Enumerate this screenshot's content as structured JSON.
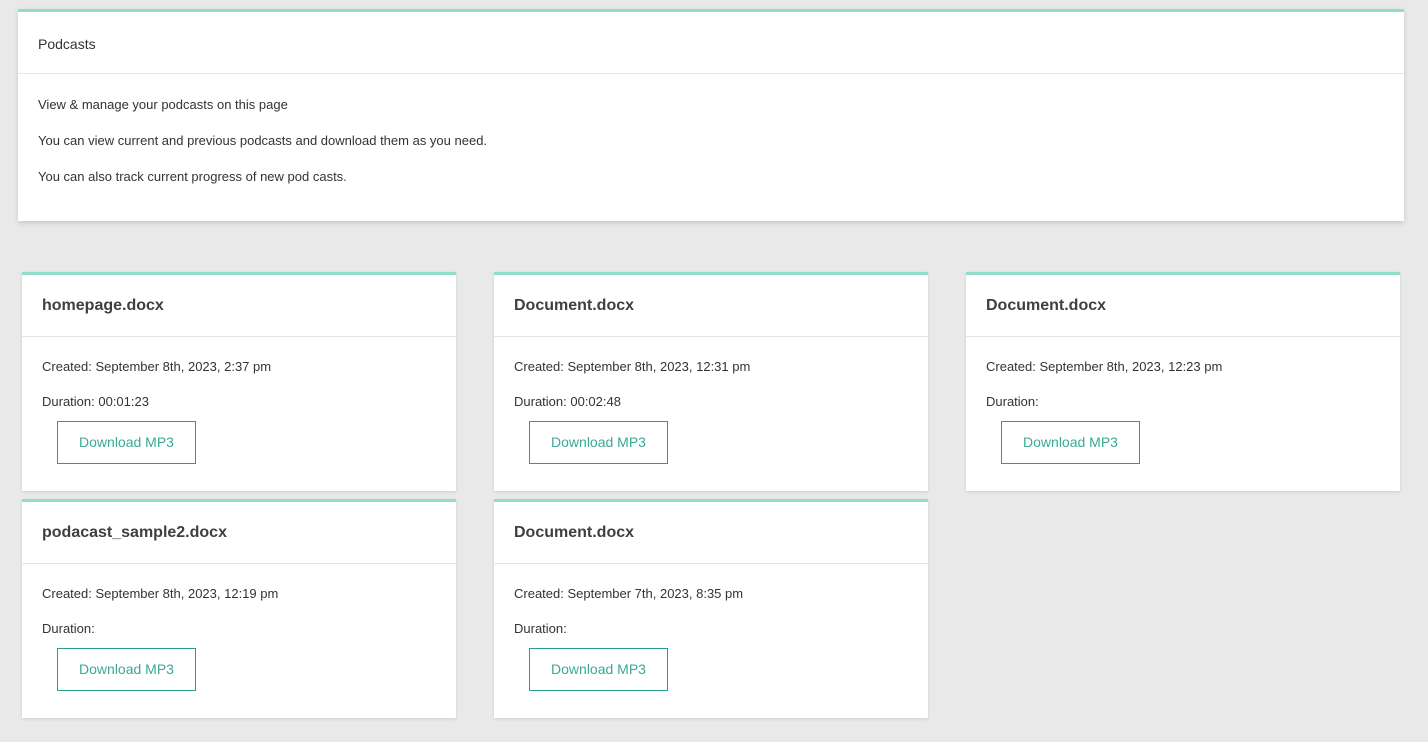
{
  "header": {
    "title": "Podcasts",
    "lines": [
      "View & manage your podcasts on this page",
      "You can view current and previous podcasts and download them as you need.",
      "You can also track current progress of new pod casts."
    ]
  },
  "podcasts": [
    {
      "title": "homepage.docx",
      "created": "Created: September 8th, 2023, 2:37 pm",
      "duration": "Duration: 00:01:23",
      "button": "Download MP3"
    },
    {
      "title": "Document.docx",
      "created": "Created: September 8th, 2023, 12:31 pm",
      "duration": "Duration: 00:02:48",
      "button": "Download MP3"
    },
    {
      "title": "Document.docx",
      "created": "Created: September 8th, 2023, 12:23 pm",
      "duration": "Duration:",
      "button": "Download MP3"
    },
    {
      "title": "podacast_sample2.docx",
      "created": "Created: September 8th, 2023, 12:19 pm",
      "duration": "Duration:",
      "button": "Download MP3"
    },
    {
      "title": "Document.docx",
      "created": "Created: September 7th, 2023, 8:35 pm",
      "duration": "Duration:",
      "button": "Download MP3"
    }
  ],
  "colors": {
    "accent": "#8fdecd",
    "button_border": "#2a9d8f",
    "button_text": "#3aa896",
    "background": "#e9e9e9"
  }
}
